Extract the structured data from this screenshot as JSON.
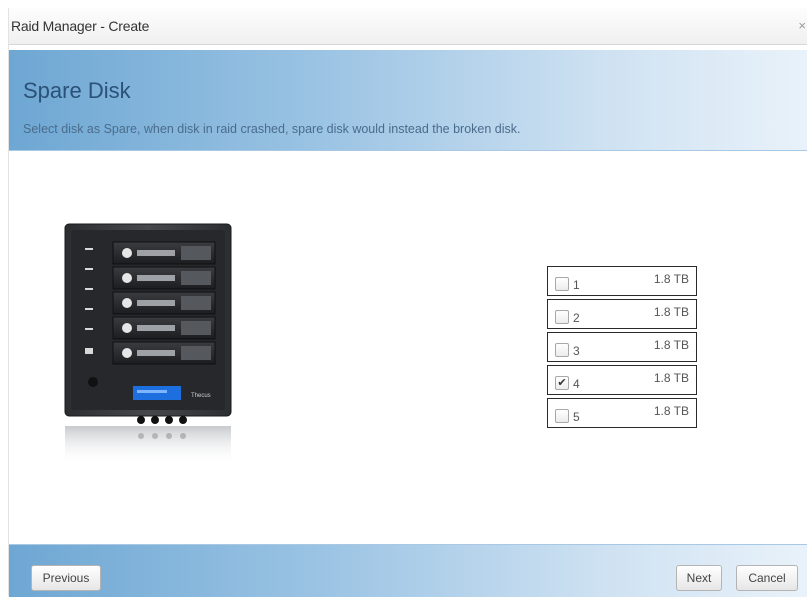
{
  "window": {
    "title": "Raid Manager - Create",
    "close_glyph": "×"
  },
  "header": {
    "title": "Spare Disk",
    "description": "Select disk as Spare, when disk in raid crashed, spare disk would instead the broken disk."
  },
  "device": {
    "brand_label": "Thecus",
    "icon": "nas-device-image"
  },
  "disks": [
    {
      "number": "1",
      "size": "1.8 TB",
      "checked": false
    },
    {
      "number": "2",
      "size": "1.8 TB",
      "checked": false
    },
    {
      "number": "3",
      "size": "1.8 TB",
      "checked": false
    },
    {
      "number": "4",
      "size": "1.8 TB",
      "checked": true
    },
    {
      "number": "5",
      "size": "1.8 TB",
      "checked": false
    }
  ],
  "footer": {
    "previous_label": "Previous",
    "next_label": "Next",
    "cancel_label": "Cancel"
  },
  "colors": {
    "header_gradient_start": "#6ea7d3",
    "header_title": "#2a5177"
  }
}
